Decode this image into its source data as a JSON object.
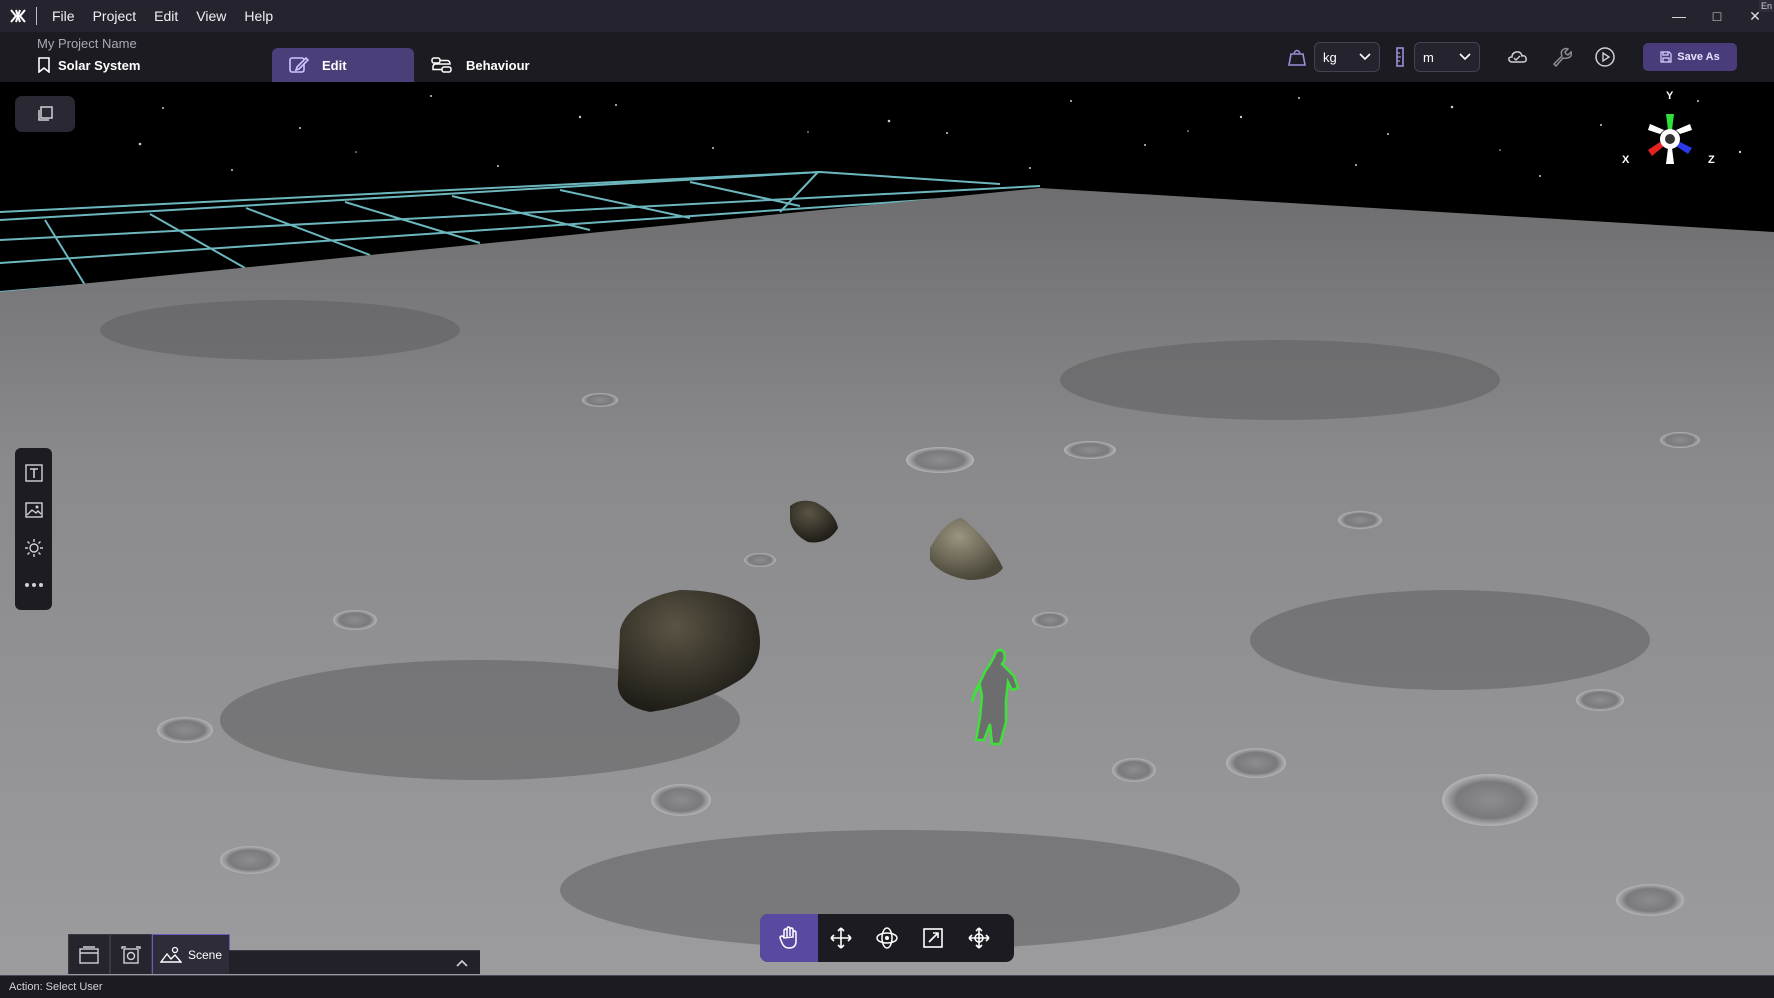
{
  "menu": {
    "items": [
      "File",
      "Project",
      "Edit",
      "View",
      "Help"
    ],
    "corner_tag": "En"
  },
  "project": {
    "name": "My Project Name",
    "scene": "Solar System"
  },
  "tabs": {
    "edit": "Edit",
    "behaviour": "Behaviour"
  },
  "units": {
    "mass": "kg",
    "length": "m"
  },
  "actions": {
    "save_as": "Save As"
  },
  "gizmo": {
    "x": "X",
    "y": "Y",
    "z": "Z"
  },
  "panel": {
    "scene_tab": "Scene"
  },
  "status": {
    "text": "Action: Select User"
  },
  "colors": {
    "accent": "#4b3f79",
    "selection_outline": "#3fe03a",
    "grid_line": "#7fd8e0"
  }
}
